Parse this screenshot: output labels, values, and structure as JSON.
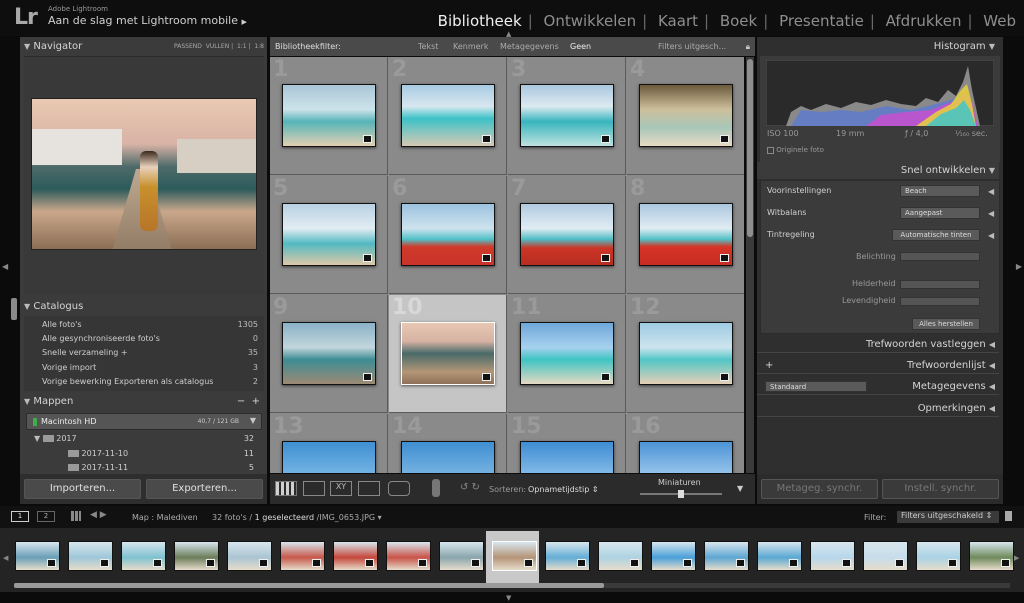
{
  "top": {
    "app": "Adobe Lightroom",
    "sync": "Aan de slag met Lightroom mobile",
    "modules": [
      "Bibliotheek",
      "Ontwikkelen",
      "Kaart",
      "Boek",
      "Presentatie",
      "Afdrukken",
      "Web"
    ]
  },
  "navigator": {
    "title": "Navigator",
    "opts": [
      "PASSEND",
      "VULLEN",
      "1:1",
      "1:8"
    ]
  },
  "catalog": {
    "title": "Catalogus",
    "rows": [
      {
        "label": "Alle foto's",
        "count": "1305"
      },
      {
        "label": "Alle gesynchroniseerde foto's",
        "count": "0"
      },
      {
        "label": "Snelle verzameling +",
        "count": "35"
      },
      {
        "label": "Vorige import",
        "count": "3"
      },
      {
        "label": "Vorige bewerking Exporteren als catalogus",
        "count": "2"
      }
    ]
  },
  "folders": {
    "title": "Mappen",
    "drive": "Macintosh HD",
    "drive_size": "40,7 / 121 GB",
    "rows": [
      {
        "label": "2017",
        "count": "32"
      },
      {
        "label": "2017-11-10",
        "count": "11"
      },
      {
        "label": "2017-11-11",
        "count": "5"
      }
    ]
  },
  "buttons": {
    "import": "Importeren...",
    "export": "Exporteren..."
  },
  "filterbar": {
    "label": "Bibliotheekfilter:",
    "opts": [
      "Tekst",
      "Kenmerk",
      "Metagegevens",
      "Geen"
    ],
    "right": "Filters uitgesch..."
  },
  "grid": {
    "numbers": [
      "1",
      "2",
      "3",
      "4",
      "5",
      "6",
      "7",
      "8",
      "9",
      "10",
      "11",
      "12",
      "13",
      "14",
      "15",
      "16"
    ]
  },
  "toolbar": {
    "sort_label": "Sorteren:",
    "sort_value": "Opnametijdstip",
    "thumbs_label": "Miniaturen"
  },
  "histogram": {
    "title": "Histogram",
    "iso": "ISO 100",
    "focal": "19 mm",
    "aperture": "ƒ / 4,0",
    "shutter": "¹⁄₁₆₀ sec.",
    "original": "Originele foto"
  },
  "quick": {
    "title": "Snel ontwikkelen",
    "preset_label": "Voorinstellingen",
    "preset_value": "Beach",
    "wb_label": "Witbalans",
    "wb_value": "Aangepast",
    "tone_label": "Tintregeling",
    "tone_auto": "Automatische tinten",
    "exposure": "Belichting",
    "clarity": "Helderheid",
    "vibrance": "Levendigheid",
    "reset": "Alles herstellen"
  },
  "right_panels": {
    "keywording": "Trefwoorden vastleggen",
    "keyword_list": "Trefwoordenlijst",
    "metadata": "Metagegevens",
    "metadata_preset": "Standaard",
    "comments": "Opmerkingen",
    "sync_meta": "Metageg. synchr.",
    "sync_settings": "Instell. synchr."
  },
  "filmstrip": {
    "page1": "1",
    "page2": "2",
    "source": "Map : Malediven",
    "count": "32 foto's / ",
    "selected": "1 geselecteerd",
    "file": " /IMG_0653.JPG ▾",
    "filter_label": "Filter:",
    "filter_value": "Filters uitgeschakeld"
  }
}
